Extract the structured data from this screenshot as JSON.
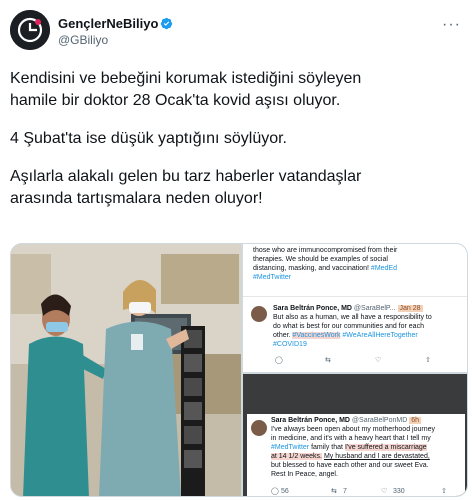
{
  "account": {
    "name": "GençlerNeBiliyo",
    "handle": "@GBiliyo",
    "avatar_text": "G",
    "more_icon": "more-horizontal-icon"
  },
  "tweet": {
    "lines": [
      "Kendisini ve bebeğini korumak istediğini söyleyen",
      "hamile bir doktor 28 Ocak'ta kovid aşısı oluyor.",
      "",
      "4 Şubat'ta ise düşük yaptığını söylüyor.",
      "",
      "Aşılarla alakalı gelen bu tarz haberler vatandaşlar",
      "arasında tartışmalara neden oluyor!"
    ]
  },
  "embedded_top": {
    "intro_lines": [
      "those who are immunocompromised from their",
      "therapies. We should be examples of social",
      "distancing, masking, and vaccination!"
    ],
    "intro_tags": "#MedEd",
    "intro_tags2": "#MedTwitter",
    "post": {
      "name": "Sara Beltrán Ponce, MD",
      "handle": "@SaraBelP...",
      "date": "Jan 28",
      "line1": "But also as a human, we all have a responsibility to",
      "line2": "do what is best for our communities and for each",
      "line3_prefix": "other.",
      "line3_tag_hl": "#VaccinesWork",
      "line3_tag": "#WeAreAllHereTogether",
      "line4_tag": "#COVID19",
      "counts": [
        "",
        "",
        "",
        ""
      ]
    }
  },
  "embedded_bottom": {
    "post": {
      "name": "Sara Beltrán Ponce, MD",
      "handle": "@SaraBelPonMD",
      "date": "6h",
      "line1": "I've always been open about my motherhood journey",
      "line2": "in medicine, and it's with a heavy heart that I tell my",
      "line3_tag": "#MedTwitter",
      "line3_mid": "family that",
      "line3_hl": "I've suffered a miscarriage",
      "line4_hl": "at 14 1/2 weeks.",
      "line4_rest": "My husband and I are devastated,",
      "line5": "but blessed to have each other and our sweet Eva.",
      "line6": "Rest In Peace, angel.",
      "reply_count": "56",
      "retweet_count": "7",
      "like_count": "330"
    }
  }
}
